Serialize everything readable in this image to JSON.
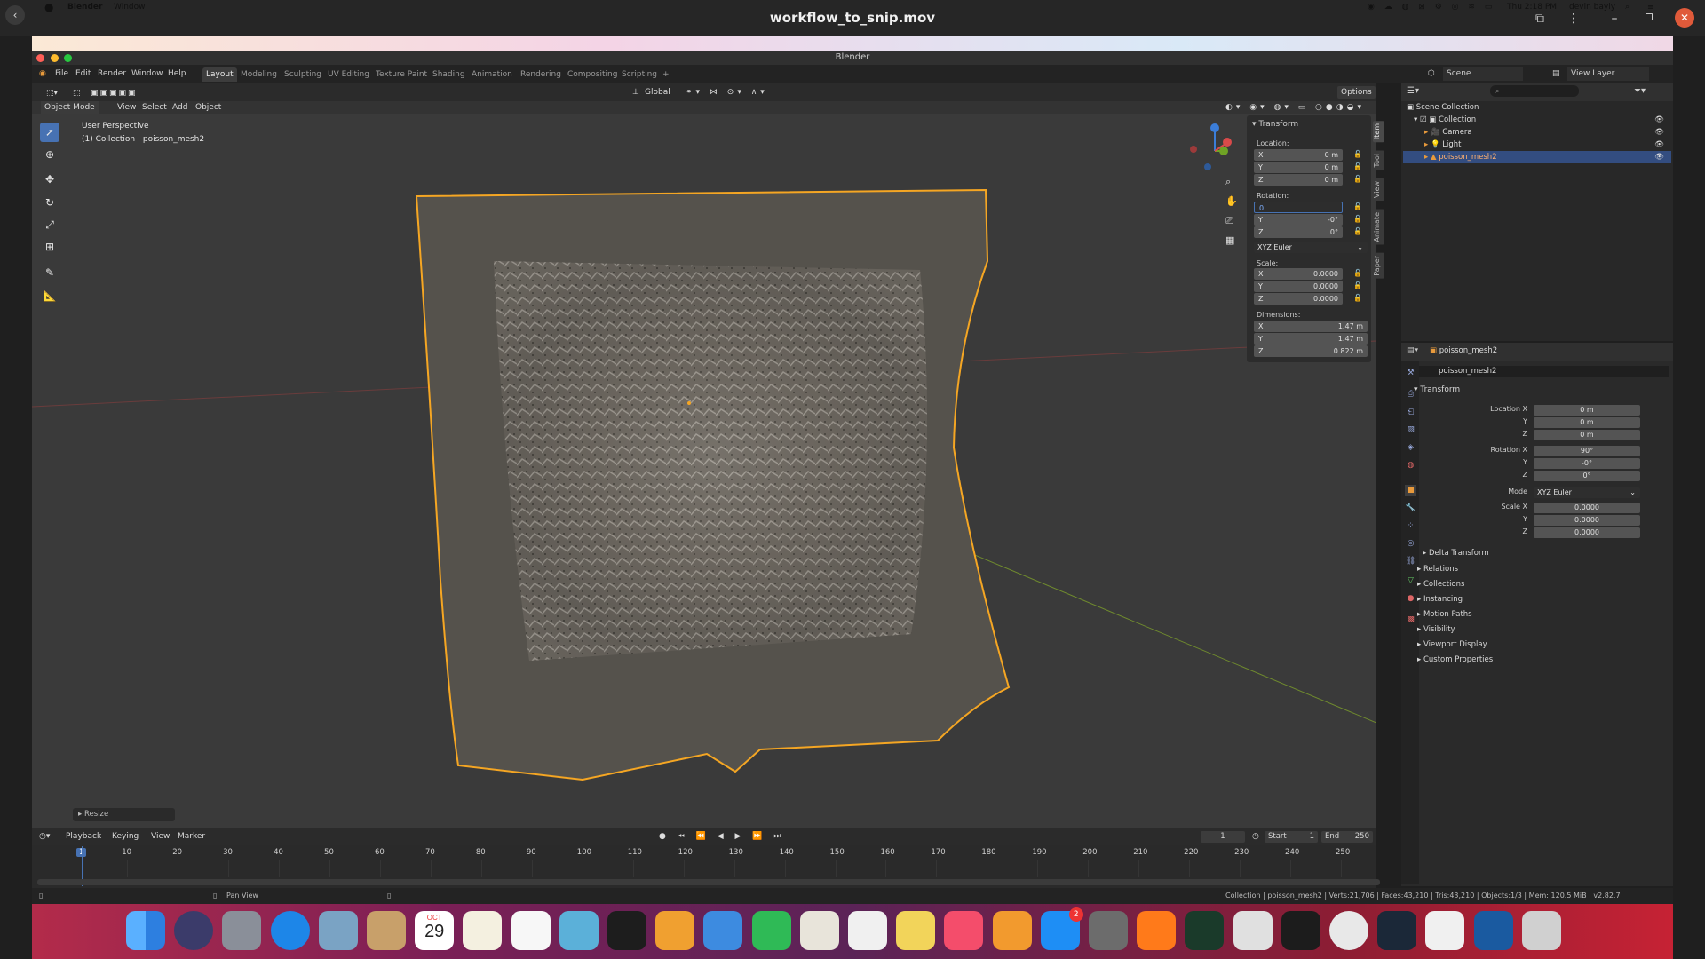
{
  "player": {
    "title": "workflow_to_snip.mov",
    "back_icon": "chevron-left-icon",
    "minimize_label": "–",
    "restore_label": "❐",
    "close_label": "✕"
  },
  "mac_menubar": {
    "apple": "",
    "app": "Blender",
    "menu": [
      "Window"
    ],
    "clock": "Thu 2:18 PM",
    "user": "devin bayly"
  },
  "blender": {
    "window_title": "Blender",
    "menus": [
      "File",
      "Edit",
      "Render",
      "Window",
      "Help"
    ],
    "workspaces": [
      "Layout",
      "Modeling",
      "Sculpting",
      "UV Editing",
      "Texture Paint",
      "Shading",
      "Animation",
      "Rendering",
      "Compositing",
      "Scripting"
    ],
    "active_workspace": "Layout",
    "scene": "Scene",
    "view_layer": "View Layer",
    "options": "Options",
    "orientation": "Global"
  },
  "viewport": {
    "mode": "Object Mode",
    "menus": [
      "View",
      "Select",
      "Add",
      "Object"
    ],
    "info_line1": "User Perspective",
    "info_line2": "(1) Collection | poisson_mesh2",
    "last_op": "Resize"
  },
  "npanel": {
    "section": "Transform",
    "location_label": "Location:",
    "location": [
      {
        "axis": "X",
        "val": "0 m"
      },
      {
        "axis": "Y",
        "val": "0 m"
      },
      {
        "axis": "Z",
        "val": "0 m"
      }
    ],
    "rotation_label": "Rotation:",
    "rotation": [
      {
        "axis": "",
        "val": "0"
      },
      {
        "axis": "Y",
        "val": "-0°"
      },
      {
        "axis": "Z",
        "val": "0°"
      }
    ],
    "rotation_mode": "XYZ Euler",
    "scale_label": "Scale:",
    "scale": [
      {
        "axis": "X",
        "val": "0.0000"
      },
      {
        "axis": "Y",
        "val": "0.0000"
      },
      {
        "axis": "Z",
        "val": "0.0000"
      }
    ],
    "dimensions_label": "Dimensions:",
    "dimensions": [
      {
        "axis": "X",
        "val": "1.47 m"
      },
      {
        "axis": "Y",
        "val": "1.47 m"
      },
      {
        "axis": "Z",
        "val": "0.822 m"
      }
    ],
    "tabs": [
      "Item",
      "Tool",
      "View",
      "Animate",
      "Paper"
    ]
  },
  "outliner": {
    "root": "Scene Collection",
    "rows": [
      {
        "label": "Collection"
      },
      {
        "label": "Camera"
      },
      {
        "label": "Light"
      },
      {
        "label": "poisson_mesh2"
      }
    ]
  },
  "properties": {
    "object_name": "poisson_mesh2",
    "object_field": "poisson_mesh2",
    "section": "Transform",
    "location_x_label": "Location X",
    "loc": [
      "0 m",
      "0 m",
      "0 m"
    ],
    "rotation_x_label": "Rotation X",
    "rot": [
      "90°",
      "-0°",
      "0°"
    ],
    "mode_label": "Mode",
    "mode": "XYZ Euler",
    "scale_x_label": "Scale X",
    "scale": [
      "0.0000",
      "0.0000",
      "0.0000"
    ],
    "y_label": "Y",
    "z_label": "Z",
    "subsections": [
      "Delta Transform",
      "Relations",
      "Collections",
      "Instancing",
      "Motion Paths",
      "Visibility",
      "Viewport Display",
      "Custom Properties"
    ]
  },
  "timeline": {
    "menus": [
      "Playback",
      "Keying",
      "View",
      "Marker"
    ],
    "current_frame": "1",
    "start_label": "Start",
    "start": "1",
    "end_label": "End",
    "end": "250",
    "ticks": [
      "1",
      "10",
      "20",
      "30",
      "40",
      "50",
      "60",
      "70",
      "80",
      "90",
      "100",
      "110",
      "120",
      "130",
      "140",
      "150",
      "160",
      "170",
      "180",
      "190",
      "200",
      "210",
      "220",
      "230",
      "240",
      "250"
    ]
  },
  "status": {
    "left": "Pan View",
    "right": "Collection | poisson_mesh2 | Verts:21,706 | Faces:43,210 | Tris:43,210 | Objects:1/3 | Mem: 120.5 MiB | v2.82.7"
  },
  "dock": {
    "calendar_month": "OCT",
    "calendar_day": "29",
    "badge": "2"
  },
  "colors": {
    "accent": "#4772b3",
    "selection_orange": "#f5a623",
    "outliner_selected": "#334d80"
  }
}
